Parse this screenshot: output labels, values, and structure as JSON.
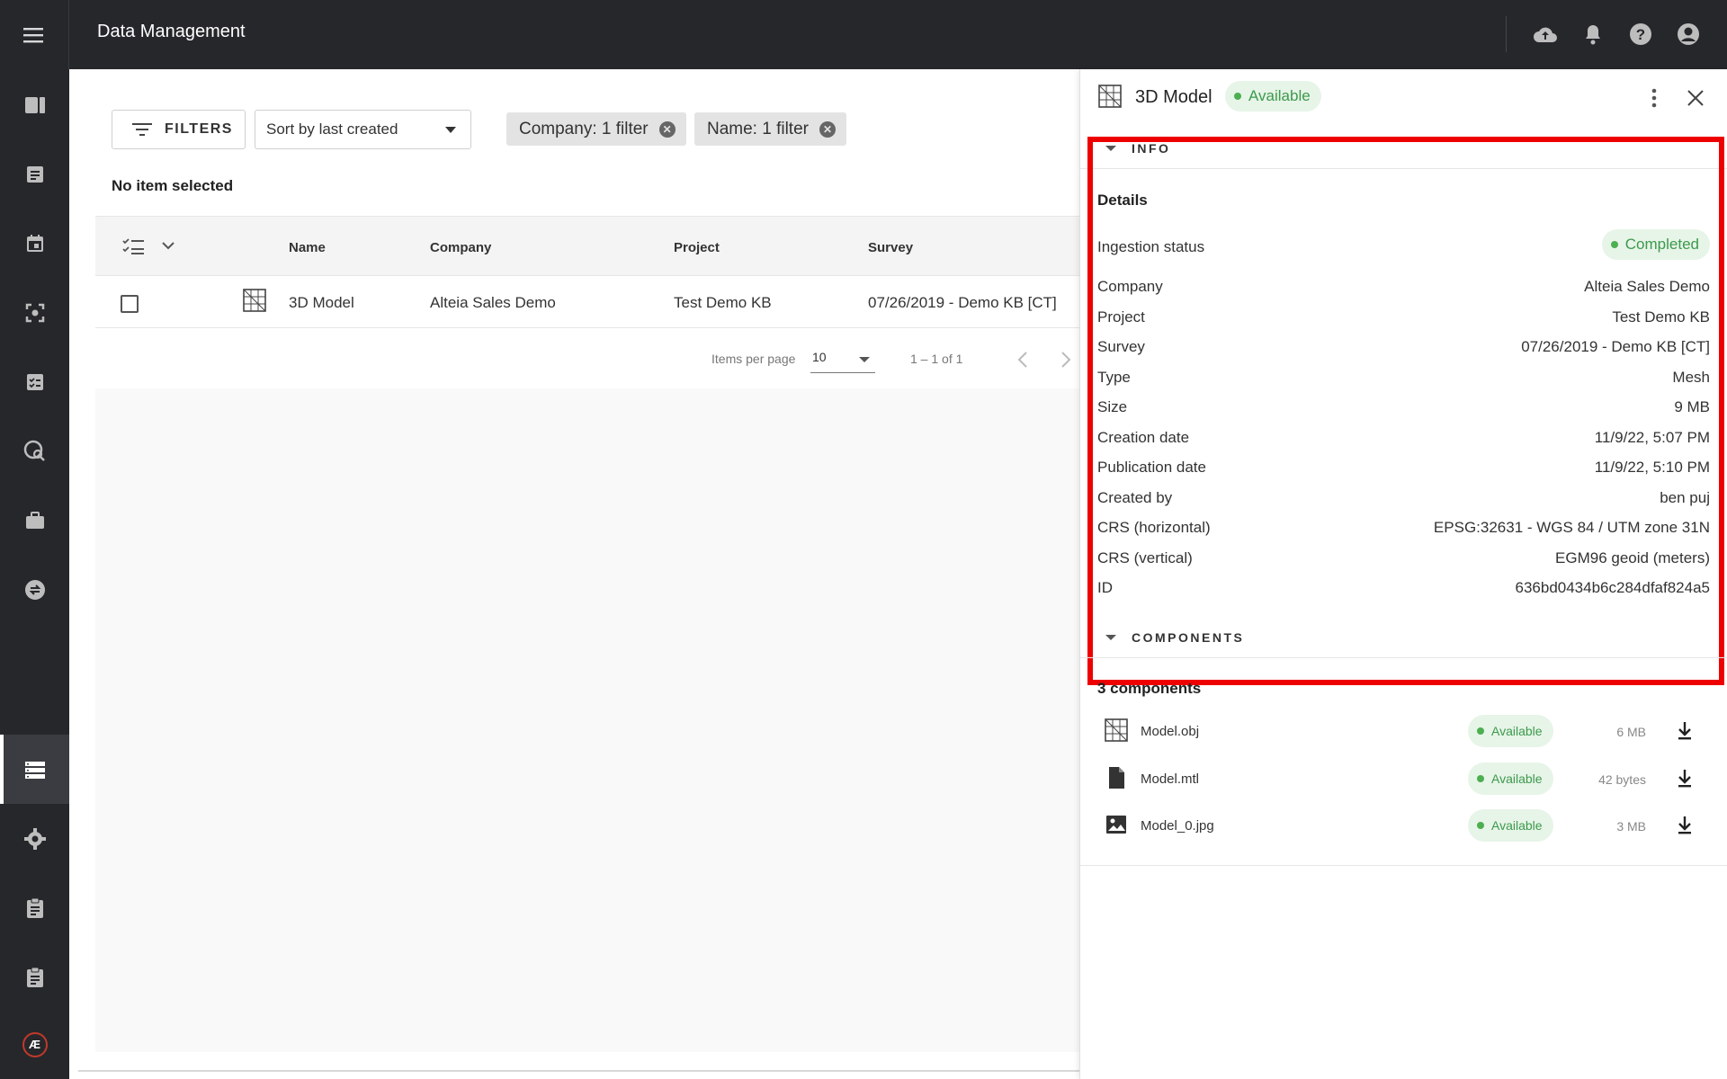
{
  "app": {
    "title": "Data Management"
  },
  "toolbar": {
    "filters_label": "FILTERS",
    "sort_value": "Sort by last created",
    "chips": [
      "Company: 1 filter",
      "Name: 1 filter"
    ]
  },
  "selection": {
    "text": "No item selected"
  },
  "table": {
    "columns": [
      "Name",
      "Company",
      "Project",
      "Survey"
    ],
    "rows": [
      {
        "name": "3D Model",
        "company": "Alteia Sales Demo",
        "project": "Test Demo KB",
        "survey": "07/26/2019 - Demo KB [CT]"
      }
    ]
  },
  "pagination": {
    "label": "Items per page",
    "per_page": "10",
    "range": "1 – 1 of 1"
  },
  "panel": {
    "title": "3D Model",
    "status": "Available",
    "info": {
      "section_label": "INFO",
      "details_heading": "Details",
      "ingestion_label": "Ingestion status",
      "ingestion_value": "Completed",
      "rows": [
        {
          "k": "Company",
          "v": "Alteia Sales Demo"
        },
        {
          "k": "Project",
          "v": "Test Demo KB"
        },
        {
          "k": "Survey",
          "v": "07/26/2019 - Demo KB [CT]"
        },
        {
          "k": "Type",
          "v": "Mesh"
        },
        {
          "k": "Size",
          "v": "9 MB"
        },
        {
          "k": "Creation date",
          "v": "11/9/22, 5:07 PM"
        },
        {
          "k": "Publication date",
          "v": "11/9/22, 5:10 PM"
        },
        {
          "k": "Created by",
          "v": "ben puj"
        },
        {
          "k": "CRS (horizontal)",
          "v": "EPSG:32631 - WGS 84 / UTM zone 31N"
        },
        {
          "k": "CRS (vertical)",
          "v": "EGM96 geoid (meters)"
        },
        {
          "k": "ID",
          "v": "636bd0434b6c284dfaf824a5"
        }
      ]
    },
    "components": {
      "section_label": "COMPONENTS",
      "heading": "3 components",
      "items": [
        {
          "name": "Model.obj",
          "status": "Available",
          "size": "6 MB",
          "icon": "mesh-icon"
        },
        {
          "name": "Model.mtl",
          "status": "Available",
          "size": "42 bytes",
          "icon": "file-icon"
        },
        {
          "name": "Model_0.jpg",
          "status": "Available",
          "size": "3 MB",
          "icon": "image-icon"
        }
      ]
    }
  },
  "nav_icons": [
    "book-icon",
    "document-icon",
    "calendar-icon",
    "scan-icon",
    "checklist-icon",
    "map-search-icon",
    "briefcase-icon",
    "sync-icon",
    "storage-icon",
    "gear-icon",
    "clipboard-icon",
    "clipboard-icon",
    "alteia-logo"
  ],
  "logo_text": "Æ",
  "colors": {
    "topbar": "#26272b",
    "available_bg": "#e7f4e8",
    "available_text": "#3c9a4c",
    "highlight": "#ee0000"
  }
}
